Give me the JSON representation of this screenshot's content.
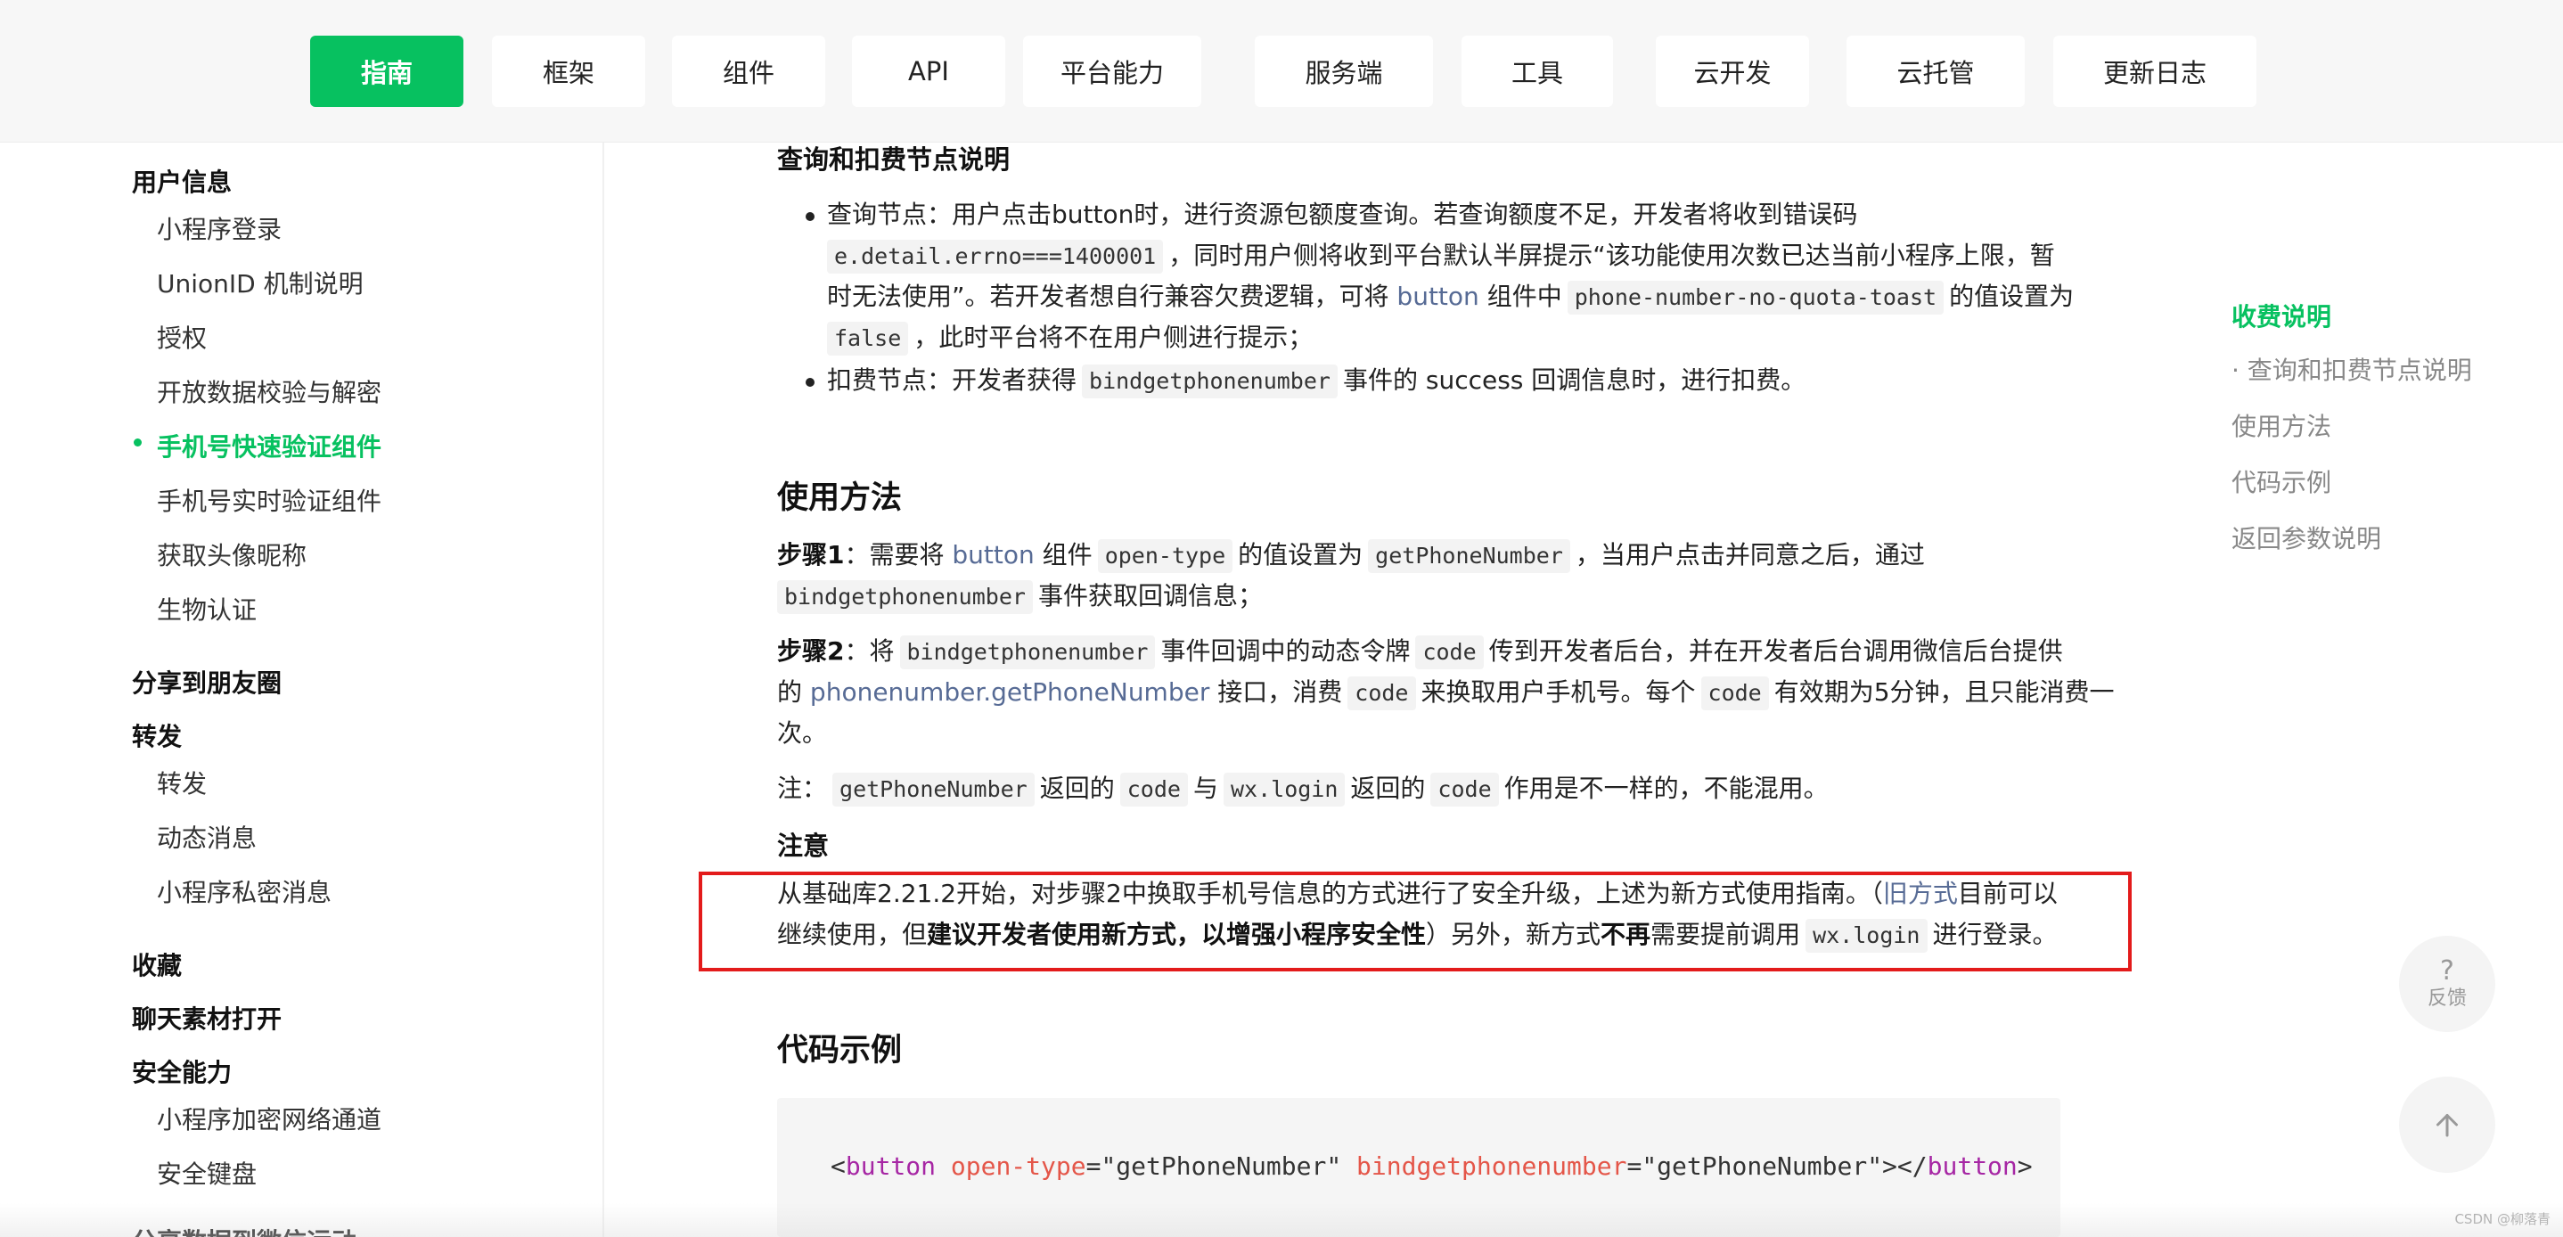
{
  "topnav": {
    "tabs": [
      {
        "label": "指南",
        "active": true
      },
      {
        "label": "框架"
      },
      {
        "label": "组件"
      },
      {
        "label": "API"
      },
      {
        "label": "平台能力"
      },
      {
        "label": "服务端"
      },
      {
        "label": "工具"
      },
      {
        "label": "云开发"
      },
      {
        "label": "云托管"
      },
      {
        "label": "更新日志"
      }
    ]
  },
  "sidebar": {
    "group_user": "用户信息",
    "user_items": [
      "小程序登录",
      "UnionID 机制说明",
      "授权",
      "开放数据校验与解密",
      "手机号快速验证组件",
      "手机号实时验证组件",
      "获取头像昵称",
      "生物认证"
    ],
    "active_item": "手机号快速验证组件",
    "group_moments": "分享到朋友圈",
    "group_forward": "转发",
    "forward_items": [
      "转发",
      "动态消息",
      "小程序私密消息"
    ],
    "group_favorite": "收藏",
    "group_chat": "聊天素材打开",
    "group_security": "安全能力",
    "security_items": [
      "小程序加密网络通道",
      "安全键盘"
    ],
    "group_cut": "分享数据到微信运动"
  },
  "content": {
    "section_query": "查询和扣费节点说明",
    "b1_label": "查询节点：",
    "b1_text_1": "用户点击button时，进行资源包额度查询。若查询额度不足，开发者将收到错误码",
    "b1_code_1": "e.detail.errno===1400001",
    "b1_text_2": "，同时用户侧将收到平台默认半屏提示“该功能使用次数已达当前小程序上限，暂",
    "b1_text_3": "时无法使用”。若开发者想自行兼容欠费逻辑，可将",
    "b1_link": "button",
    "b1_text_4": "组件中",
    "b1_code_2": "phone-number-no-quota-toast",
    "b1_text_5": "的值设置为",
    "b1_code_3": "false",
    "b1_text_6": "，此时平台将不在用户侧进行提示；",
    "b2_label": "扣费节点：",
    "b2_text_1": "开发者获得",
    "b2_code": "bindgetphonenumber",
    "b2_text_2": "事件的 success 回调信息时，进行扣费。",
    "usage_title": "使用方法",
    "s1_label": "步骤1",
    "s1_text_1": "：需要将",
    "s1_link": "button",
    "s1_text_2": "组件",
    "s1_code_1": "open-type",
    "s1_text_3": "的值设置为",
    "s1_code_2": "getPhoneNumber",
    "s1_text_4": "，当用户点击并同意之后，通过",
    "s1_code_3": "bindgetphonenumber",
    "s1_text_5": "事件获取回调信息；",
    "s2_label": "步骤2",
    "s2_text_1": "：将",
    "s2_code_1": "bindgetphonenumber",
    "s2_text_2": "事件回调中的动态令牌",
    "s2_code_2": "code",
    "s2_text_3": "传到开发者后台，并在开发者后台调用微信后台提供",
    "s2_text_4": "的",
    "s2_link": "phonenumber.getPhoneNumber",
    "s2_text_5": "接口，消费",
    "s2_code_3": "code",
    "s2_text_6": "来换取用户手机号。每个",
    "s2_code_4": "code",
    "s2_text_7": "有效期为5分钟，且只能消费一",
    "s2_text_8": "次。",
    "note_prefix": "注：",
    "note_code_1": "getPhoneNumber",
    "note_text_1": "返回的",
    "note_code_2": "code",
    "note_text_2": "与",
    "note_code_3": "wx.login",
    "note_text_3": "返回的",
    "note_code_4": "code",
    "note_text_4": "作用是不一样的，不能混用。",
    "attention_title": "注意",
    "att_text_1": "从基础库2.21.2开始，对步骤2中换取手机号信息的方式进行了安全升级，上述为新方式使用指南。（",
    "att_link": "旧方式",
    "att_text_2": "目前可以",
    "att_text_3": "继续使用，但",
    "att_bold_1": "建议开发者使用新方式，以增强小程序安全性",
    "att_text_4": "）另外，新方式",
    "att_bold_2": "不再",
    "att_text_5": "需要提前调用",
    "att_code": "wx.login",
    "att_text_6": "进行登录。",
    "example_title": "代码示例",
    "code_sample": {
      "lt": "<",
      "tag": "button",
      "attr1": "open-type",
      "val1": "=\"getPhoneNumber\"",
      "attr2": "bindgetphonenumber",
      "val2": "=\"getPhoneNumber\"",
      "mid": "></",
      "end_tag": "button",
      "gt": ">"
    }
  },
  "toc": {
    "items": [
      "收费说明",
      "· 查询和扣费节点说明",
      "使用方法",
      "代码示例",
      "返回参数说明"
    ],
    "active": "收费说明"
  },
  "floating": {
    "feedback_icon": "?",
    "feedback_label": "反馈",
    "top_icon": "arrow-up-icon"
  },
  "watermark": "CSDN @柳落青",
  "colors": {
    "accent": "#07c160",
    "link": "#576b95",
    "highlight_border": "#e31b1b"
  }
}
